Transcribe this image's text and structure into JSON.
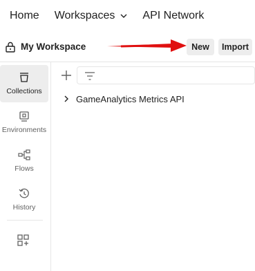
{
  "topnav": {
    "home": "Home",
    "workspaces": "Workspaces",
    "api_network": "API Network"
  },
  "workspace": {
    "title": "My Workspace",
    "new_label": "New",
    "import_label": "Import"
  },
  "rail": {
    "items": [
      {
        "label": "Collections",
        "icon": "collections-icon"
      },
      {
        "label": "Environments",
        "icon": "environments-icon"
      },
      {
        "label": "Flows",
        "icon": "flows-icon"
      },
      {
        "label": "History",
        "icon": "history-icon"
      }
    ],
    "extra_icon": "configure-sidebar-icon"
  },
  "collections": [
    {
      "name": "GameAnalytics Metrics API"
    }
  ],
  "colors": {
    "annotation_arrow": "#e01010",
    "active_bg": "#ededed",
    "button_bg": "#ededed"
  }
}
